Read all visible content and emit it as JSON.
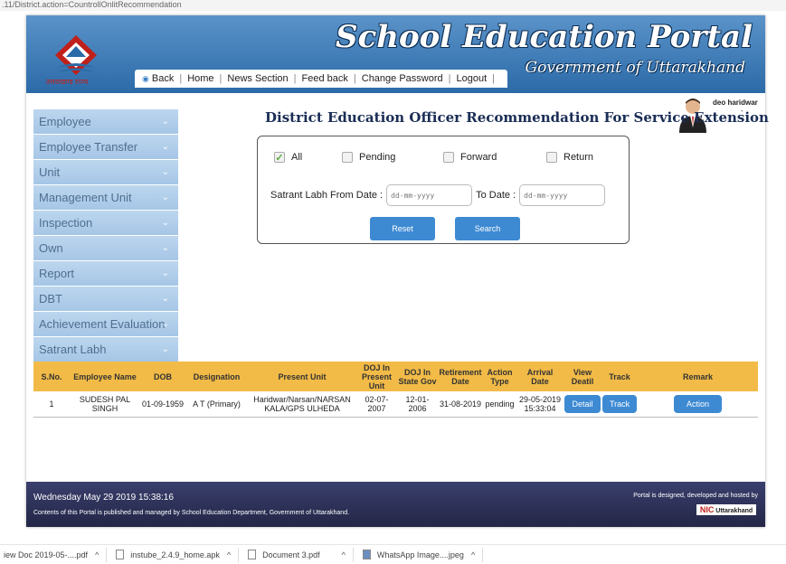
{
  "browser": {
    "url": ".11/District.action=CountrollOnlitRecommendation"
  },
  "header": {
    "logo_text": "उत्तराखण्ड राज्य",
    "portal_title": "School Education Portal",
    "portal_subtitle": "Government of Uttarakhand",
    "nav": {
      "back": "Back",
      "home": "Home",
      "news": "News Section",
      "feedback": "Feed back",
      "change_password": "Change Password",
      "logout": "Logout"
    },
    "user": {
      "name": "deo haridwar",
      "dash": "-"
    }
  },
  "sidebar": {
    "items": [
      {
        "label": "Employee"
      },
      {
        "label": "Employee Transfer"
      },
      {
        "label": "Unit"
      },
      {
        "label": "Management Unit"
      },
      {
        "label": "Inspection"
      },
      {
        "label": "Own"
      },
      {
        "label": "Report"
      },
      {
        "label": "DBT"
      },
      {
        "label": "Achievement Evaluation"
      },
      {
        "label": "Satrant Labh"
      }
    ]
  },
  "main": {
    "heading": "District Education Officer Recommendation For Service Extension",
    "filters": {
      "all": "All",
      "pending": "Pending",
      "forward": "Forward",
      "return": "Return",
      "all_checked": true,
      "from_label": "Satrant Labh From Date :",
      "from_placeholder": "dd-mm-yyyy",
      "to_label": "To Date :",
      "to_placeholder": "dd-mm-yyyy",
      "reset": "Reset",
      "search": "Search"
    },
    "table": {
      "headers": {
        "sno": "S.No.",
        "name": "Employee Name",
        "dob": "DOB",
        "designation": "Designation",
        "unit": "Present Unit",
        "doj_unit": "DOJ In Present Unit",
        "doj_gov": "DOJ In State Gov",
        "retirement": "Retirement Date",
        "action_type": "Action Type",
        "arrival": "Arrival Date",
        "view": "View Deatil",
        "track": "Track",
        "remark": "Remark"
      },
      "rows": [
        {
          "sno": "1",
          "name": "SUDESH PAL SINGH",
          "dob": "01-09-1959",
          "designation": "A T (Primary)",
          "unit": "Haridwar/Narsan/NARSAN KALA/GPS ULHEDA",
          "doj_unit": "02-07-2007",
          "doj_gov": "12-01-2006",
          "retirement": "31-08-2019",
          "action_type": "pending",
          "arrival": "29-05-2019 15:33:04",
          "view": "Detail",
          "track": "Track",
          "remark": "Action"
        }
      ]
    }
  },
  "footer": {
    "datetime": "Wednesday May 29 2019 15:38:16",
    "note": "Contents of this Portal is published and managed by School Education Department, Government of Uttarakhand.",
    "credit": "Portal is designed, developed and hosted by",
    "nic": "NIC",
    "nic_suffix": "Uttarakhand"
  },
  "downloads": [
    {
      "name": "iew Doc 2019-05-....pdf"
    },
    {
      "name": "instube_2.4.9_home.apk"
    },
    {
      "name": "Document 3.pdf"
    },
    {
      "name": "WhatsApp Image....jpeg"
    }
  ],
  "colors": {
    "header_blue": "#2b6aa8",
    "table_header": "#f2bb47",
    "button_blue": "#3d8ad3",
    "footer": "#232646",
    "sidebar": "#a6c6e6"
  }
}
